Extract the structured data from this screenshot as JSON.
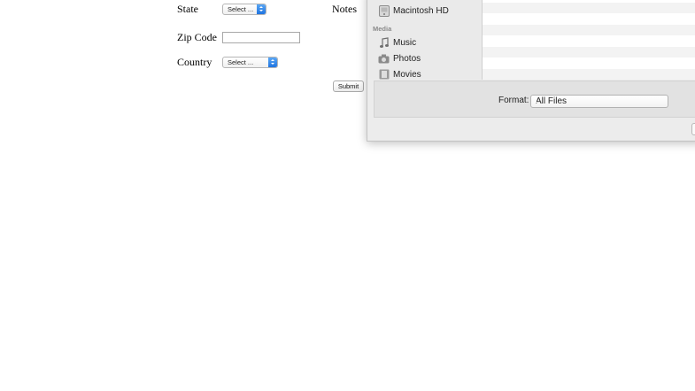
{
  "form": {
    "state_label": "State",
    "state_select": "Select ...",
    "notes_label": "Notes",
    "zip_label": "Zip Code",
    "zip_value": "",
    "country_label": "Country",
    "country_select": "Select ...",
    "submit_label": "Submit"
  },
  "dialog": {
    "sidebar": {
      "device_item": "Macintosh HD",
      "media_heading": "Media",
      "media_items": [
        "Music",
        "Photos",
        "Movies"
      ]
    },
    "format_label": "Format:",
    "format_value": "All Files"
  },
  "colors": {
    "select_accent": "#1f74e0",
    "dialog_bg": "#ececec"
  }
}
